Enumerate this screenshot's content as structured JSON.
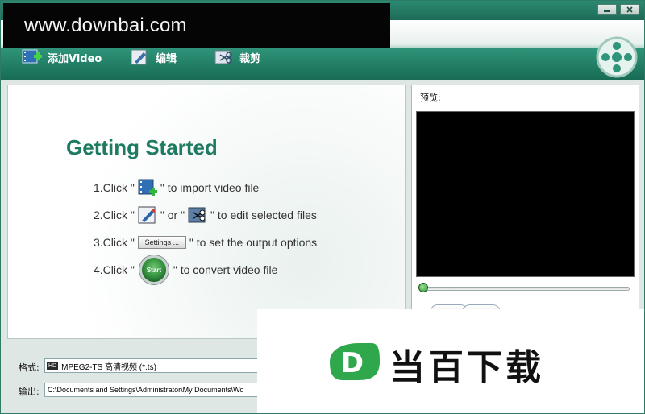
{
  "watermark": {
    "text": "www.downbai.com",
    "brand_name": "当百下载",
    "brand_letter": "D"
  },
  "toolbar": {
    "items": [
      {
        "label": "添加Video",
        "icon": "add-video-icon"
      },
      {
        "label": "编辑",
        "icon": "edit-icon"
      },
      {
        "label": "裁剪",
        "icon": "trim-icon"
      }
    ]
  },
  "main": {
    "title": "Getting Started",
    "steps": {
      "s1_prefix": "1.Click \"",
      "s1_suffix": "\" to import video file",
      "s2_prefix": "2.Click \"",
      "s2_mid": "\" or \"",
      "s2_suffix": "\"  to edit selected files",
      "s3_prefix": "3.Click \"",
      "s3_button": "Settings ...",
      "s3_suffix": "\" to set the output options",
      "s4_prefix": "4.Click \"",
      "s4_button": "Start",
      "s4_suffix": "\" to convert video file"
    }
  },
  "preview": {
    "label": "预览:",
    "seek_position": 0
  },
  "format": {
    "label": "格式:",
    "badge": "HD",
    "value": "MPEG2-TS 高清视频 (*.ts)"
  },
  "output": {
    "label": "输出:",
    "value": "C:\\Documents and Settings\\Administrator\\My Documents\\Wo"
  },
  "colors": {
    "accent": "#1e7a61",
    "title_bar": "#2d8a72"
  }
}
